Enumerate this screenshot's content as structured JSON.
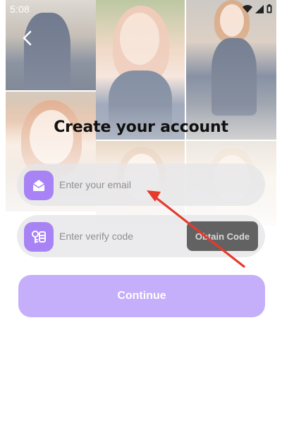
{
  "status_bar": {
    "time": "5:08"
  },
  "icons": {
    "back": "back-arrow-icon",
    "email": "envelope-icon",
    "code": "key-code-icon",
    "wifi": "wifi-icon",
    "signal": "signal-icon",
    "battery": "battery-icon"
  },
  "header": {
    "title": "Create your account"
  },
  "email_field": {
    "placeholder": "Enter your email",
    "value": ""
  },
  "code_field": {
    "placeholder": "Enter verify code",
    "value": "",
    "obtain_label": "Obtain Code"
  },
  "continue": {
    "label": "Continue"
  },
  "colors": {
    "accent": "#a883f5",
    "continue_bg": "#c5aefa",
    "obtain_bg": "#626262",
    "annotation_arrow": "#e53a2c"
  }
}
